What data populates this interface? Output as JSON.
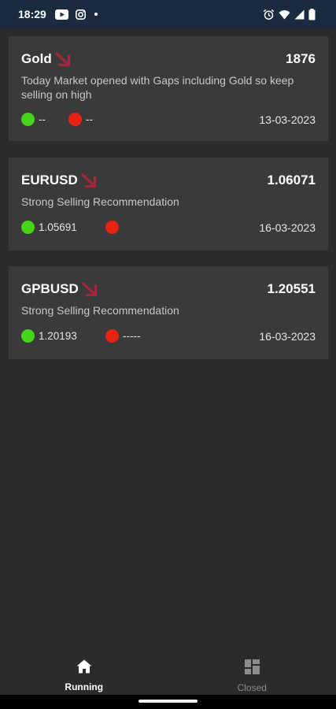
{
  "status_bar": {
    "time": "18:29",
    "icons": [
      "youtube-icon",
      "instagram-icon",
      "notification-dot",
      "alarm-icon",
      "wifi-icon",
      "signal-icon",
      "battery-icon"
    ]
  },
  "colors": {
    "status_bar_bg": "#1b2b3f",
    "background": "#2b2b2b",
    "card_bg": "#3a3a3a",
    "down_arrow": "#a8243f",
    "target_green": "#44d41a",
    "stop_red": "#e52313"
  },
  "signals": [
    {
      "symbol": "Gold",
      "direction_icon": "trend-down-arrow-icon",
      "price": "1876",
      "description": "Today Market opened with Gaps including Gold so keep selling on high",
      "target": "--",
      "stop_loss": "--",
      "date": "13-03-2023"
    },
    {
      "symbol": "EURUSD",
      "direction_icon": "trend-down-arrow-icon",
      "price": "1.06071",
      "description": "Strong Selling Recommendation",
      "target": "1.05691",
      "stop_loss": "",
      "date": "16-03-2023"
    },
    {
      "symbol": "GPBUSD",
      "direction_icon": "trend-down-arrow-icon",
      "price": "1.20551",
      "description": "Strong Selling Recommendation",
      "target": "1.20193",
      "stop_loss": "-----",
      "date": "16-03-2023"
    }
  ],
  "bottom_nav": {
    "items": [
      {
        "label": "Running",
        "icon": "home-icon",
        "active": true
      },
      {
        "label": "Closed",
        "icon": "grid-icon",
        "active": false
      }
    ]
  }
}
